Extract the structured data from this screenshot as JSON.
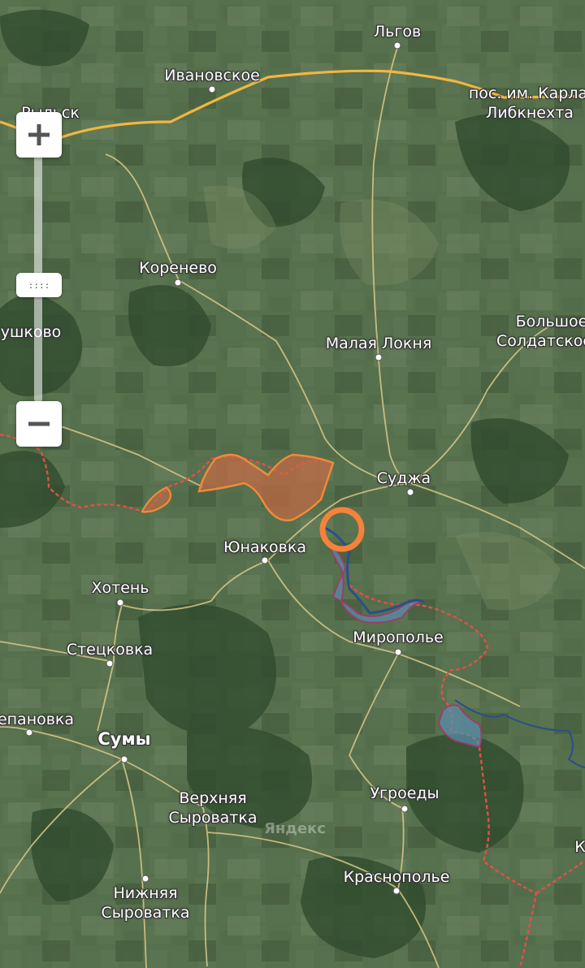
{
  "map": {
    "watermark": "Яндекс",
    "road_color": "#f2b640",
    "minor_road_color": "#d9c98a",
    "border_color": "#e0504a",
    "occupied_fill": "#c86a45",
    "occupied_outline": "#f08a3a",
    "contested_fill": "#5a8fb0",
    "contested_outline": "#2a4f8a",
    "marker_color": "#f5823a",
    "labels": [
      {
        "id": "lgov",
        "text": "Льгов",
        "bold": false
      },
      {
        "id": "ivanovskoe",
        "text": "Ивановское",
        "bold": false
      },
      {
        "id": "rylsk",
        "text": "Рыльск",
        "bold": false
      },
      {
        "id": "karl1",
        "text": "пос. им. Карла",
        "bold": false
      },
      {
        "id": "karl2",
        "text": "Либкнехта",
        "bold": false
      },
      {
        "id": "korenevo",
        "text": "Коренево",
        "bold": false
      },
      {
        "id": "glushkovo",
        "text": "ушково",
        "bold": false
      },
      {
        "id": "malaya_loknya",
        "text": "Малая Локня",
        "bold": false
      },
      {
        "id": "bolshoe1",
        "text": "Большое",
        "bold": false
      },
      {
        "id": "bolshoe2",
        "text": "Солдатское",
        "bold": false
      },
      {
        "id": "sudzha",
        "text": "Суджа",
        "bold": false
      },
      {
        "id": "yunakovka",
        "text": "Юнаковка",
        "bold": false
      },
      {
        "id": "khoten",
        "text": "Хотень",
        "bold": false
      },
      {
        "id": "miropolye",
        "text": "Миропольe",
        "bold": false
      },
      {
        "id": "stetskovka",
        "text": "Стецковка",
        "bold": false
      },
      {
        "id": "stepanovka",
        "text": "епановка",
        "bold": false
      },
      {
        "id": "sumy",
        "text": "Сумы",
        "bold": true
      },
      {
        "id": "verkh1",
        "text": "Верхняя",
        "bold": false
      },
      {
        "id": "verkh2",
        "text": "Сыроватка",
        "bold": false
      },
      {
        "id": "ugroedy",
        "text": "Угроеды",
        "bold": false
      },
      {
        "id": "krasnopolye",
        "text": "Краснополье",
        "bold": false
      },
      {
        "id": "nizh1",
        "text": "Нижняя",
        "bold": false
      },
      {
        "id": "nizh2",
        "text": "Сыроватка",
        "bold": false
      },
      {
        "id": "edge_k",
        "text": "К",
        "bold": false
      }
    ]
  },
  "controls": {
    "zoom_in_icon": "plus-icon",
    "zoom_out_icon": "minus-icon",
    "handle_grip": "::::"
  }
}
